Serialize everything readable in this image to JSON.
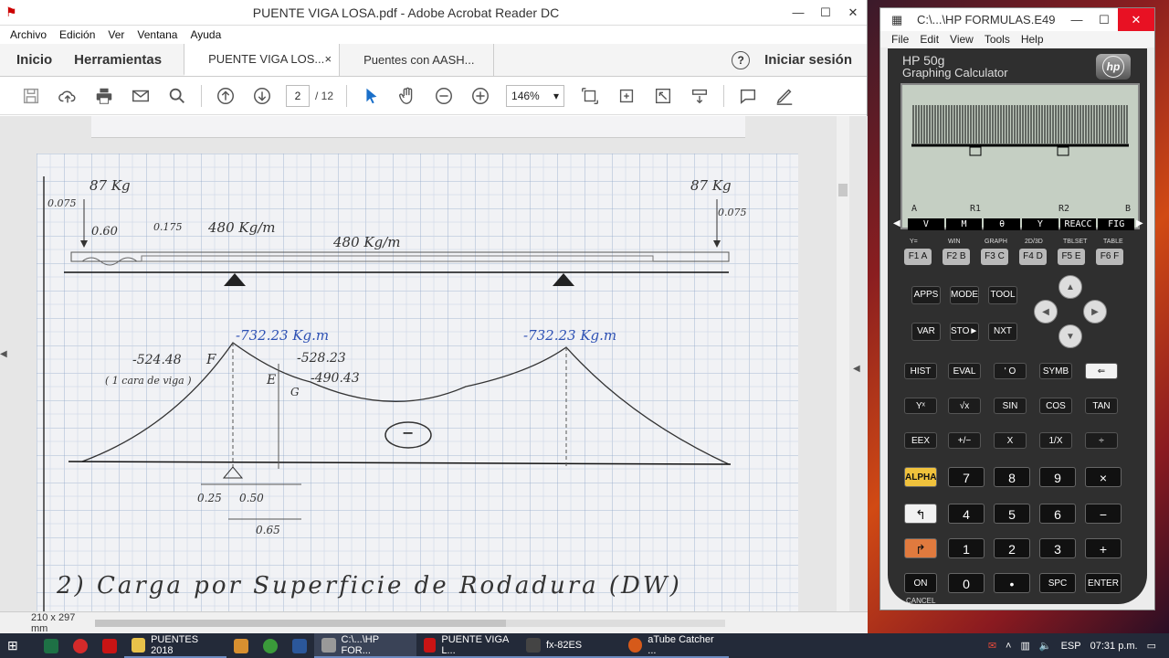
{
  "acrobat": {
    "title": "PUENTE VIGA LOSA.pdf - Adobe Acrobat Reader DC",
    "menu": [
      "Archivo",
      "Edición",
      "Ver",
      "Ventana",
      "Ayuda"
    ],
    "nav_home": "Inicio",
    "nav_tools": "Herramientas",
    "tabs": [
      {
        "label": "PUENTE VIGA LOS...",
        "close": "×"
      },
      {
        "label": "Puentes con AASH..."
      }
    ],
    "help_glyph": "?",
    "signin": "Iniciar sesión",
    "page_current": "2",
    "page_total": "/ 12",
    "zoom": "146%",
    "page_size": "210 x 297 mm"
  },
  "drawing": {
    "load_left": "87 Kg",
    "load_right": "87 Kg",
    "dim_0075_left": "0.075",
    "dim_0075_right": "0.075",
    "dim_060": "0.60",
    "dim_0175": "0.175",
    "dist_load_1": "480 Kg/m",
    "dist_load_2": "480 Kg/m",
    "moment_left": "-732.23 Kg.m",
    "moment_right": "-732.23 Kg.m",
    "m_524": "-524.48",
    "m_528": "-528.23",
    "m_490": "-490.43",
    "pt_F": "F",
    "pt_E": "E",
    "pt_G": "G",
    "note": "( 1 cara de viga )",
    "sign": "−",
    "dim_025": "0.25",
    "dim_050": "0.50",
    "dim_065": "0.65",
    "heading": "2) Carga por Superficie de Rodadura (DW)"
  },
  "calculator": {
    "title": "C:\\...\\HP FORMULAS.E49",
    "menu": [
      "File",
      "Edit",
      "View",
      "Tools",
      "Help"
    ],
    "brand_line1": "HP 50g",
    "brand_line2": "Graphing Calculator",
    "logo": "hp",
    "screen_labels": [
      "A",
      "R1",
      "R2",
      "B"
    ],
    "menu_keys": [
      "V",
      "M",
      "θ",
      "Y",
      "REACC",
      "FIG"
    ],
    "fkey_top": [
      "Y=",
      "WIN",
      "GRAPH",
      "2D/3D",
      "TBLSET",
      "TABLE"
    ],
    "fkeys": [
      "F1 A",
      "F2 B",
      "F3 C",
      "F4 D",
      "F5 E",
      "F6 F"
    ],
    "row_apps": [
      "APPS",
      "MODE",
      "TOOL"
    ],
    "row_var": [
      "VAR",
      "STO►",
      "NXT"
    ],
    "row_hist": [
      "HIST",
      "EVAL",
      "' O",
      "SYMB",
      "⇐"
    ],
    "row_yx": [
      "Yˣ",
      "√x",
      "SIN",
      "COS",
      "TAN"
    ],
    "row_eex": [
      "EEX",
      "+/−",
      "X",
      "1/X",
      "÷"
    ],
    "row_789": [
      "ALPHA",
      "7",
      "8",
      "9",
      "×"
    ],
    "row_456": [
      "↰",
      "4",
      "5",
      "6",
      "−"
    ],
    "row_123": [
      "↱",
      "1",
      "2",
      "3",
      "+"
    ],
    "row_0": [
      "ON",
      "0",
      "•",
      "SPC",
      "ENTER"
    ],
    "cancel": "CANCEL"
  },
  "taskbar": {
    "tasks": [
      "PUENTES 2018",
      "C:\\...\\HP FOR...",
      "PUENTE VIGA L...",
      "fx-82ES",
      "aTube Catcher ..."
    ],
    "lang": "ESP",
    "time": "07:31 p.m."
  }
}
